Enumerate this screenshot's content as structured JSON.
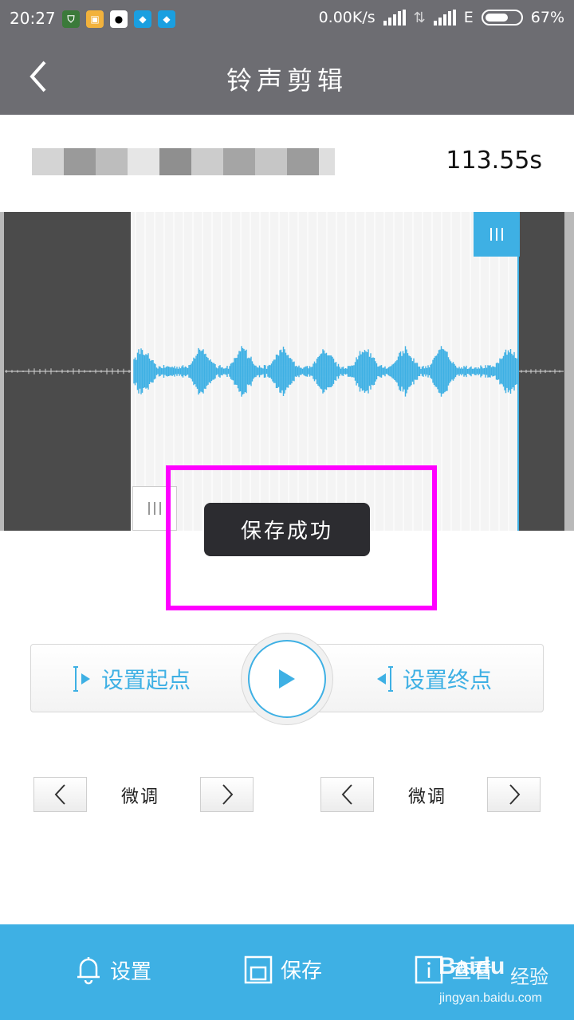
{
  "status_bar": {
    "time": "20:27",
    "network_speed": "0.00K/s",
    "network_type": "E",
    "battery_percent": "67%",
    "battery_level": 0.67,
    "notification_icons": [
      "shield-app-icon",
      "gift-app-icon",
      "qq-penguin-icon",
      "drop-app-icon",
      "drop-app-icon"
    ]
  },
  "header": {
    "title": "铃声剪辑",
    "back_icon": "chevron-left-icon"
  },
  "file": {
    "name": "",
    "duration": "113.55s"
  },
  "waveform": {
    "accent": "#3eb0e4",
    "selection_start": 0.23,
    "selection_end": 0.9
  },
  "toast": {
    "message": "保存成功"
  },
  "highlight": {
    "color": "#ff00ff"
  },
  "controls": {
    "set_start_label": "设置起点",
    "set_end_label": "设置终点",
    "play_icon": "play-icon"
  },
  "fine_tune": {
    "left_label": "微调",
    "right_label": "微调"
  },
  "bottom_bar": {
    "settings_label": "设置",
    "save_label": "保存",
    "view_label": "查看",
    "background": "#3eb0e4"
  },
  "watermark": {
    "brand": "Baidu",
    "suffix": "经验",
    "url": "jingyan.baidu.com"
  }
}
